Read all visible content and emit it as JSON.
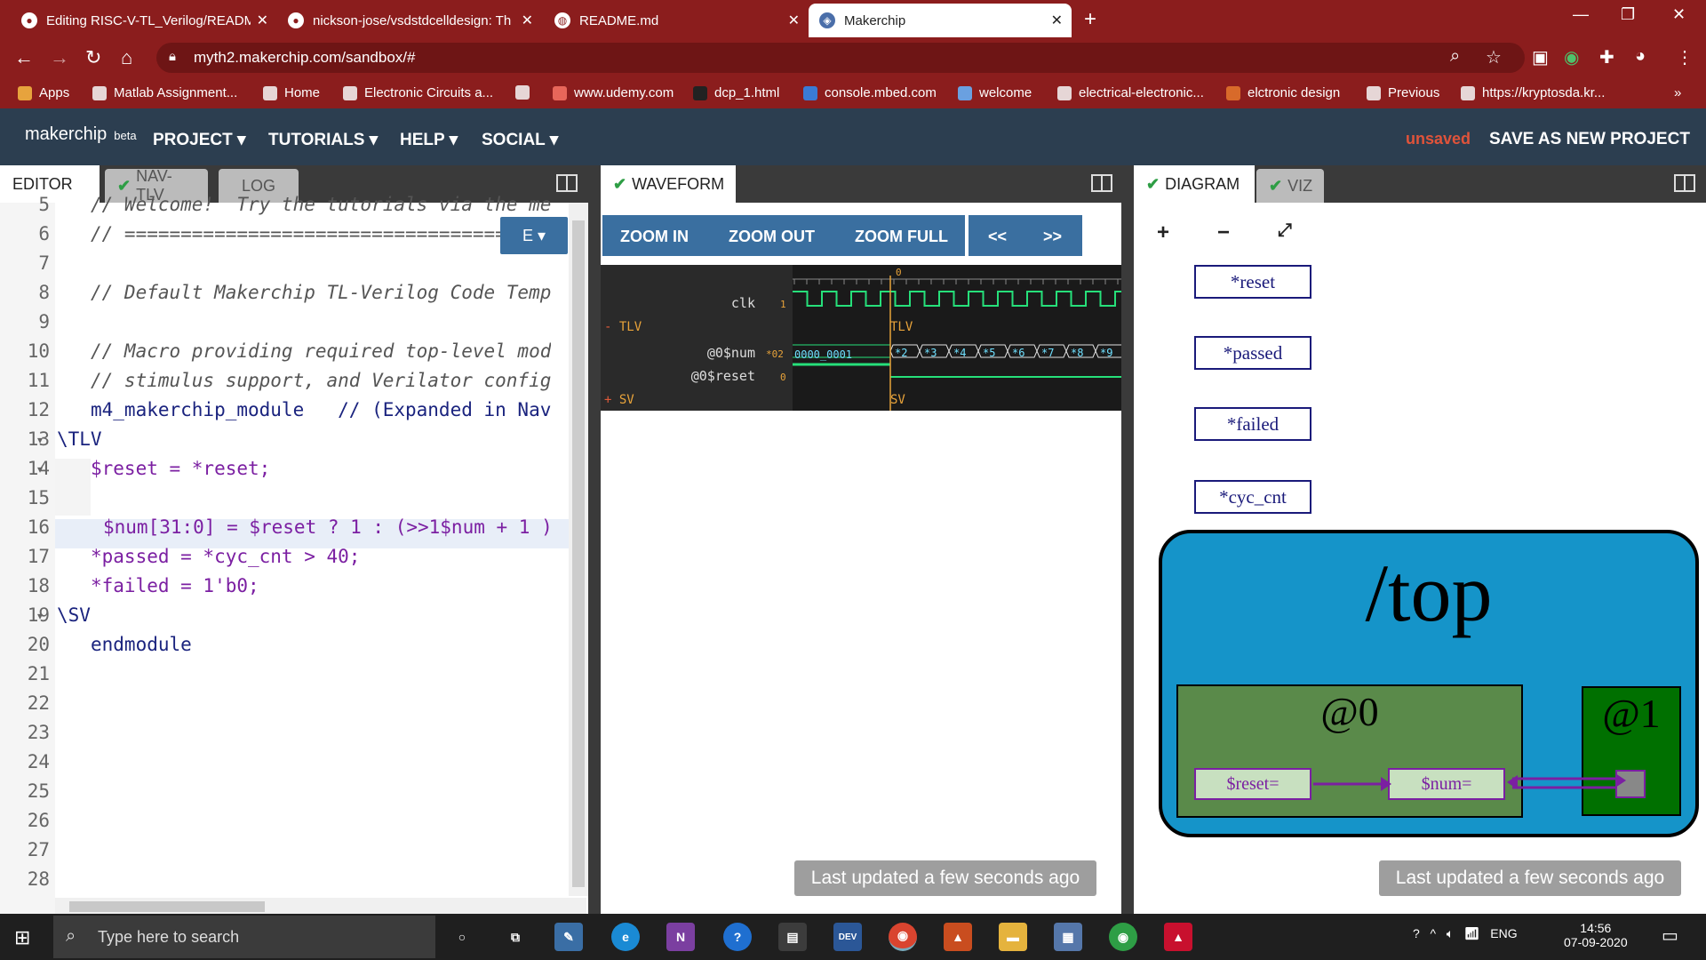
{
  "browser": {
    "tabs": [
      {
        "title": "Editing RISC-V-TL_Verilog/READM",
        "icon": "github-icon"
      },
      {
        "title": "nickson-jose/vsdstdcelldesign: Th",
        "icon": "github-icon"
      },
      {
        "title": "README.md",
        "icon": "globe-icon"
      },
      {
        "title": "Makerchip",
        "icon": "makerchip-icon"
      }
    ],
    "url": "myth2.makerchip.com/sandbox/#",
    "bookmarks": [
      "Apps",
      "Matlab Assignment...",
      "Home",
      "Electronic Circuits a...",
      "",
      "www.udemy.com",
      "dcp_1.html",
      "console.mbed.com",
      "welcome",
      "electrical-electronic...",
      "elctronic design",
      "Previous",
      "https://kryptosda.kr..."
    ],
    "bookmarks_overflow": "»"
  },
  "app": {
    "logo": "makerchip",
    "logo_tag": "beta",
    "menus": [
      "PROJECT",
      "TUTORIALS",
      "HELP",
      "SOCIAL"
    ],
    "status": "unsaved",
    "save_label": "SAVE AS NEW PROJECT"
  },
  "editor": {
    "tabs": [
      "EDITOR",
      "NAV-TLV",
      "LOG"
    ],
    "mode_button": "E",
    "lines": [
      {
        "n": "5",
        "text": "// Welcome!  Try the tutorials via the me",
        "cls": "cmt"
      },
      {
        "n": "6",
        "text": "// ==================================",
        "cls": "cmt"
      },
      {
        "n": "7",
        "text": "",
        "cls": ""
      },
      {
        "n": "8",
        "text": "// Default Makerchip TL-Verilog Code Temp",
        "cls": "cmt"
      },
      {
        "n": "9",
        "text": "",
        "cls": ""
      },
      {
        "n": "10",
        "text": "// Macro providing required top-level mod",
        "cls": "cmt"
      },
      {
        "n": "11",
        "text": "// stimulus support, and Verilator config",
        "cls": "cmt"
      },
      {
        "n": "12",
        "text": "m4_makerchip_module   // (Expanded in Nav",
        "cls": "kw"
      },
      {
        "n": "13",
        "text": "\\TLV",
        "cls": "kw"
      },
      {
        "n": "14",
        "text": "$reset = *reset;",
        "cls": "sig"
      },
      {
        "n": "15",
        "text": "",
        "cls": ""
      },
      {
        "n": "16",
        "text": "$num[31:0] = $reset ? 1 : (>>1$num + 1 )",
        "cls": "sig"
      },
      {
        "n": "17",
        "text": "*passed = *cyc_cnt > 40;",
        "cls": "sig"
      },
      {
        "n": "18",
        "text": "*failed = 1'b0;",
        "cls": "sig"
      },
      {
        "n": "19",
        "text": "\\SV",
        "cls": "kw"
      },
      {
        "n": "20",
        "text": "endmodule",
        "cls": "kw"
      },
      {
        "n": "21",
        "text": "",
        "cls": ""
      },
      {
        "n": "22",
        "text": "",
        "cls": ""
      },
      {
        "n": "23",
        "text": "",
        "cls": ""
      },
      {
        "n": "24",
        "text": "",
        "cls": ""
      },
      {
        "n": "25",
        "text": "",
        "cls": ""
      },
      {
        "n": "26",
        "text": "",
        "cls": ""
      },
      {
        "n": "27",
        "text": "",
        "cls": ""
      },
      {
        "n": "28",
        "text": "",
        "cls": ""
      }
    ]
  },
  "waveform": {
    "tab": "WAVEFORM",
    "buttons": [
      "ZOOM IN",
      "ZOOM OUT",
      "ZOOM FULL"
    ],
    "nav": [
      "<<",
      ">>"
    ],
    "cursor_label": "0",
    "signals": [
      {
        "name": "clk",
        "value": "1"
      },
      {
        "name": "TLV",
        "value": ""
      },
      {
        "name": "@0$num",
        "value": "*02"
      },
      {
        "name": "@0$reset",
        "value": "0"
      },
      {
        "name": "SV",
        "value": ""
      }
    ],
    "scope_tlv": "TLV",
    "scope_sv": "SV",
    "num_first": "0000_0001",
    "num_values": [
      "*2",
      "*3",
      "*4",
      "*5",
      "*6",
      "*7",
      "*8",
      "*9"
    ],
    "last_updated": "Last updated a few seconds ago"
  },
  "diagram": {
    "tabs": [
      "DIAGRAM",
      "VIZ"
    ],
    "signals": [
      "*reset",
      "*passed",
      "*failed",
      "*cyc_cnt"
    ],
    "top": "/top",
    "stage0": "@0",
    "stage1": "@1",
    "node_reset": "$reset=",
    "node_num": "$num=",
    "last_updated": "Last updated a few seconds ago",
    "colors": {
      "top_fill": "#1594c9",
      "stage0_fill": "#5a8a4a",
      "stage1_fill": "#007000",
      "edge": "#7b1fa2"
    }
  },
  "taskbar": {
    "search_placeholder": "Type here to search",
    "lang": "ENG",
    "time": "14:56",
    "date": "07-09-2020"
  }
}
